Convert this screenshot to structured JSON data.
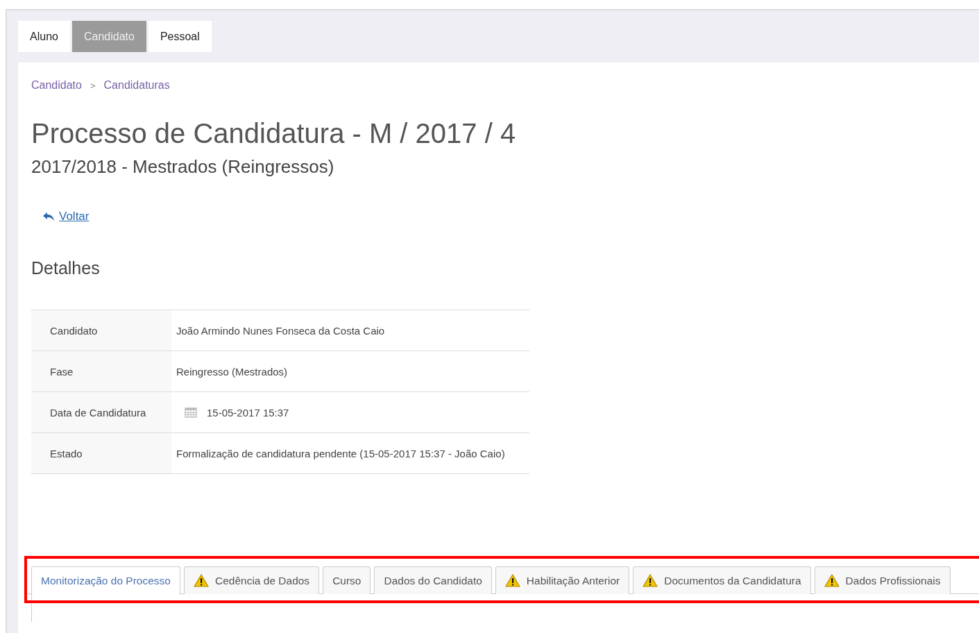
{
  "top_tabs": [
    {
      "label": "Aluno",
      "selected": false
    },
    {
      "label": "Candidato",
      "selected": true
    },
    {
      "label": "Pessoal",
      "selected": false
    }
  ],
  "breadcrumb": [
    "Candidato",
    "Candidaturas"
  ],
  "breadcrumb_separator": ">",
  "title": "Processo de Candidatura - M / 2017 / 4",
  "subtitle": "2017/2018 - Mestrados (Reingressos)",
  "back_link": "Voltar",
  "section_title": "Detalhes",
  "details": [
    {
      "label": "Candidato",
      "value": "João Armindo Nunes Fonseca da Costa Caio",
      "kind": "text"
    },
    {
      "label": "Fase",
      "value": "Reingresso (Mestrados)",
      "kind": "text"
    },
    {
      "label": "Data de Candidatura",
      "value": "15-05-2017 15:37",
      "kind": "date"
    },
    {
      "label": "Estado",
      "value": "Formalização de candidatura pendente (15-05-2017 15:37 - João Caio)",
      "kind": "text"
    }
  ],
  "process_tabs": [
    {
      "label": "Monitorização do Processo",
      "selected": true,
      "warning": false
    },
    {
      "label": "Cedência de Dados",
      "selected": false,
      "warning": true
    },
    {
      "label": "Curso",
      "selected": false,
      "warning": false
    },
    {
      "label": "Dados do Candidato",
      "selected": false,
      "warning": false
    },
    {
      "label": "Habilitação Anterior",
      "selected": false,
      "warning": true
    },
    {
      "label": "Documentos da Candidatura",
      "selected": false,
      "warning": true
    },
    {
      "label": "Dados Profissionais",
      "selected": false,
      "warning": true
    }
  ]
}
